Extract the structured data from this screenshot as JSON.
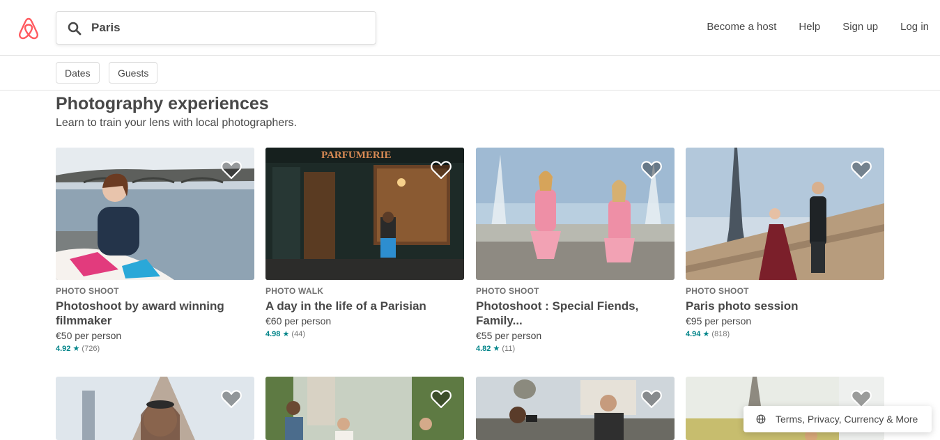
{
  "brand": {
    "logo_icon": "airbnb-logo-icon",
    "color": "#FF5A5F"
  },
  "search": {
    "value": "Paris",
    "icon": "search-icon"
  },
  "nav": [
    {
      "label": "Become a host"
    },
    {
      "label": "Help"
    },
    {
      "label": "Sign up"
    },
    {
      "label": "Log in"
    }
  ],
  "filters": [
    {
      "label": "Dates"
    },
    {
      "label": "Guests"
    }
  ],
  "section": {
    "title": "Photography experiences",
    "subtitle": "Learn to train your lens with local photographers."
  },
  "cards": [
    {
      "kind": "PHOTO SHOOT",
      "title": "Photoshoot by award winning filmmaker",
      "price": "€50 per person",
      "rating": "4.92",
      "reviews": "(726)"
    },
    {
      "kind": "PHOTO WALK",
      "title": "A day in the life of a Parisian",
      "price": "€60 per person",
      "rating": "4.98",
      "reviews": "(44)"
    },
    {
      "kind": "PHOTO SHOOT",
      "title": "Photoshoot : Special Fiends, Family...",
      "price": "€55 per person",
      "rating": "4.82",
      "reviews": "(11)"
    },
    {
      "kind": "PHOTO SHOOT",
      "title": "Paris photo session",
      "price": "€95 per person",
      "rating": "4.94",
      "reviews": "(818)"
    }
  ],
  "colors": {
    "rating": "#008489",
    "text": "#484848",
    "muted": "#717171"
  },
  "footer": {
    "label": "Terms, Privacy, Currency & More",
    "icon": "globe-icon"
  }
}
